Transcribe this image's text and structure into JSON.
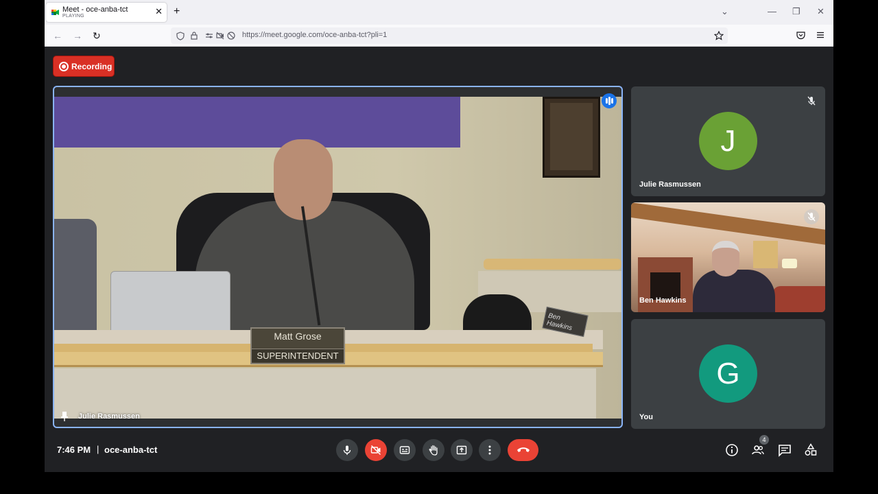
{
  "browser": {
    "tab_title": "Meet - oce-anba-tct",
    "tab_status": "PLAYING",
    "tab_close": "✕",
    "new_tab": "+",
    "url_domain": "https://meet.google.com",
    "url_path": "/oce-anba-tct?pli=1",
    "window_controls": [
      "⌄",
      "—",
      "❐",
      "✕"
    ]
  },
  "recording": {
    "label": "Recording",
    "color": "#d93025"
  },
  "main_tile": {
    "name": "Julie Rasmussen",
    "nameplate_name": "Matt Grose",
    "nameplate_title": "SUPERINTENDENT",
    "nameplate2": "Ben Hawkins",
    "highlight_color": "#8ab4f8"
  },
  "side_tiles": [
    {
      "name": "Julie Rasmussen",
      "initial": "J",
      "avatar_color": "#6aa135",
      "muted": true
    },
    {
      "name": "Ben Hawkins",
      "video": true,
      "muted": true
    },
    {
      "name": "You",
      "initial": "G",
      "avatar_color": "#129a7e"
    }
  ],
  "bottom_bar": {
    "time": "7:46 PM",
    "separator": "|",
    "meeting_code": "oce-anba-tct",
    "participant_count": "4",
    "controls": [
      "microphone-icon",
      "camera-off-icon",
      "captions-icon",
      "raise-hand-icon",
      "present-icon",
      "more-options-icon",
      "hang-up-icon"
    ],
    "right_controls": [
      "info-icon",
      "people-icon",
      "chat-icon",
      "activities-icon"
    ]
  }
}
